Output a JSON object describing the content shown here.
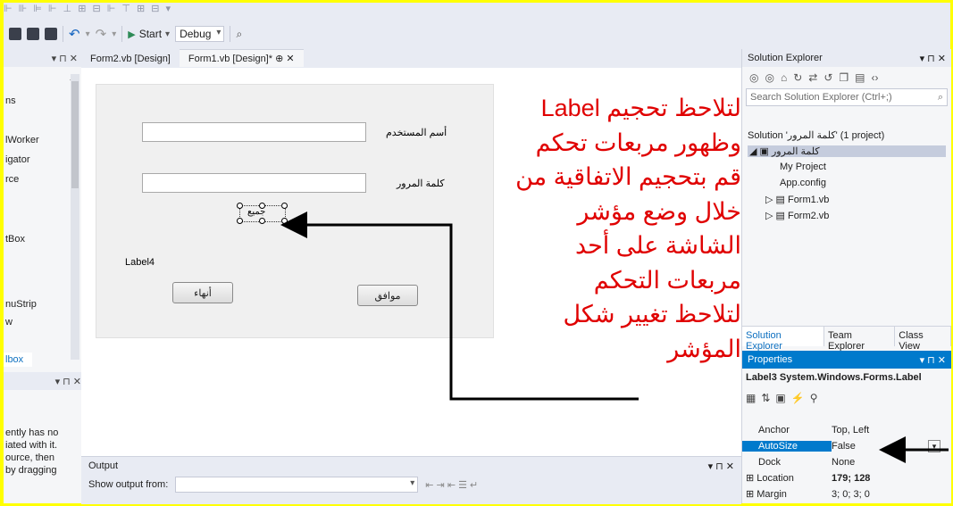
{
  "toolbar": {
    "start_label": "Start",
    "config_value": "Debug"
  },
  "toolbox": {
    "header_pin": "▾ ⊓ ✕",
    "items": [
      "ns",
      "lWorker",
      "igator",
      "rce",
      "tBox",
      "nuStrip",
      "w"
    ],
    "tab_label": "lbox",
    "bottom_text": [
      "ently has no",
      "iated with it.",
      "ource, then",
      "by dragging"
    ]
  },
  "tabs": [
    {
      "label": "Form2.vb [Design]"
    },
    {
      "label": "Form1.vb [Design]*  ⊕  ✕"
    }
  ],
  "form": {
    "username_label": "أسم المستخدم",
    "password_label": "كلمة المرور",
    "label4": "Label4",
    "selected_label_text": "جميع",
    "ok_button": "موافق",
    "cancel_button": "أنهاء"
  },
  "annotation": {
    "lines": [
      "لتلاحظ تحجيم  Label",
      "وظهور مربعات تحكم",
      "قم بتحجيم الاتفاقية من",
      "خلال وضع مؤشر",
      "الشاشة على أحد",
      "مربعات التحكم",
      "لتلاحظ تغيير شكل",
      "المؤشر"
    ]
  },
  "output": {
    "title": "Output",
    "show_from": "Show output from:"
  },
  "solution_explorer": {
    "title": "Solution Explorer",
    "search_placeholder": "Search Solution Explorer (Ctrl+;)",
    "solution": "Solution 'كلمة المرور' (1 project)",
    "project": "كلمة المرور",
    "items": [
      "My Project",
      "App.config",
      "Form1.vb",
      "Form2.vb"
    ]
  },
  "bottom_tabs": [
    "Solution Explorer",
    "Team Explorer",
    "Class View"
  ],
  "properties": {
    "title": "Properties",
    "object": "Label3  System.Windows.Forms.Label",
    "rows": [
      {
        "name": "Anchor",
        "value": "Top, Left"
      },
      {
        "name": "AutoSize",
        "value": "False"
      },
      {
        "name": "Dock",
        "value": "None"
      },
      {
        "name": "⊞ Location",
        "value": "179; 128"
      },
      {
        "name": "⊞ Margin",
        "value": "3; 0; 3; 0"
      }
    ]
  },
  "colors": {
    "accent": "#007acc",
    "annotation": "#e00000",
    "highlight": "#ffff00"
  }
}
